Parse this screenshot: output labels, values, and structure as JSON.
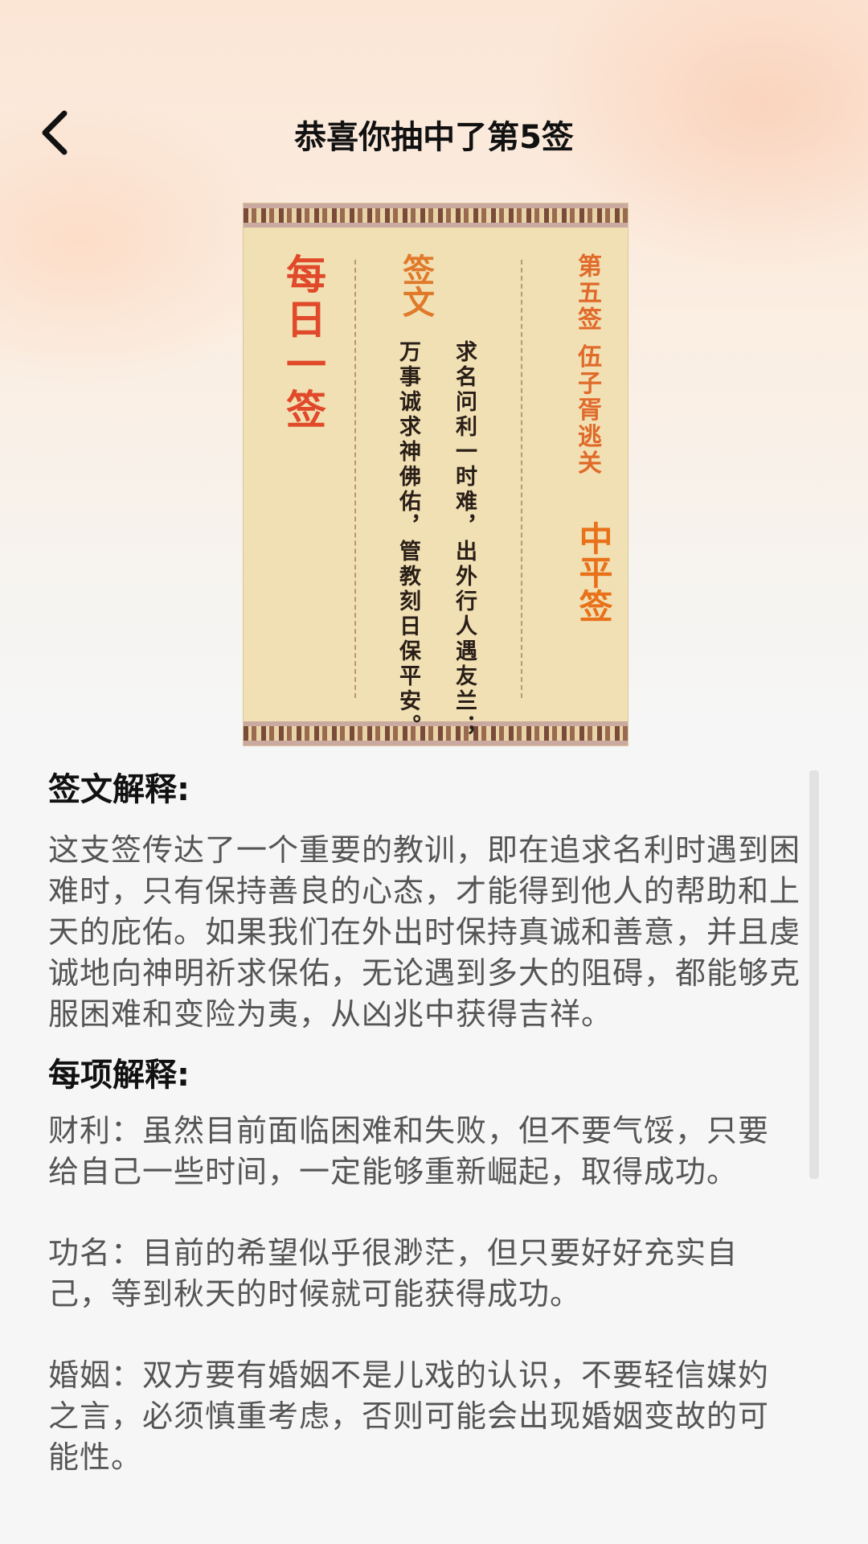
{
  "header": {
    "title": "恭喜你抽中了第5签",
    "back_icon": "chevron-left-icon"
  },
  "card": {
    "daily_label": "每日一签",
    "qianwen_label": "签文",
    "verse_line1": "求名问利一时难，出外行人遇友兰；",
    "verse_line2": "万事诚求神佛佑，管教刻日保平安。",
    "sign_number": "第五签 伍子胥逃关",
    "sign_level": "中平签"
  },
  "explanation": {
    "heading": "签文解释:",
    "text": "这支签传达了一个重要的教训，即在追求名利时遇到困难时，只有保持善良的心态，才能得到他人的帮助和上天的庇佑。如果我们在外出时保持真诚和善意，并且虔诚地向神明祈求保佑，无论遇到多大的阻碍，都能够克服困难和变险为夷，从凶兆中获得吉祥。"
  },
  "details": {
    "heading": "每项解释:",
    "items": [
      "财利：虽然目前面临困难和失败，但不要气馁，只要给自己一些时间，一定能够重新崛起，取得成功。",
      "功名：目前的希望似乎很渺茫，但只要好好充实自己，等到秋天的时候就可能获得成功。",
      "婚姻：双方要有婚姻不是儿戏的认识，不要轻信媒妁之言，必须慎重考虑，否则可能会出现婚姻变故的可能性。"
    ]
  }
}
